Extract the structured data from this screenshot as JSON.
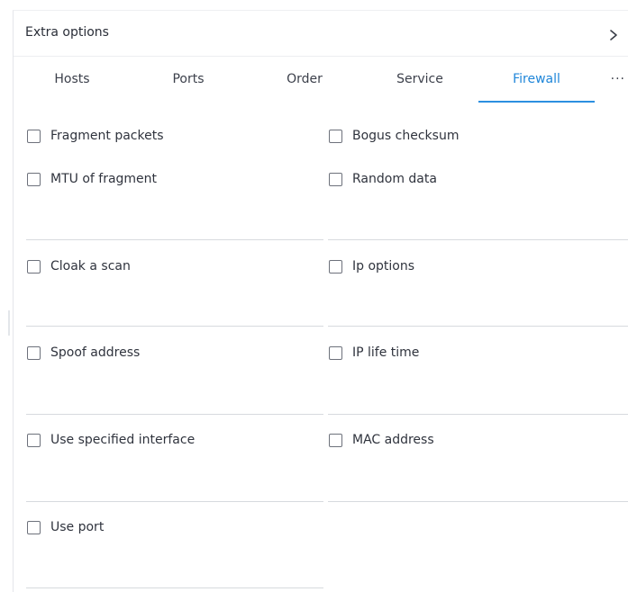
{
  "panel": {
    "title": "Extra options",
    "expand_icon": "chevron-right-icon"
  },
  "tabs": [
    {
      "label": "Hosts",
      "active": false
    },
    {
      "label": "Ports",
      "active": false
    },
    {
      "label": "Order",
      "active": false
    },
    {
      "label": "Service",
      "active": false
    },
    {
      "label": "Firewall",
      "active": true
    }
  ],
  "tabs_more": "···",
  "options": {
    "fragment_packets": {
      "label": "Fragment packets",
      "checked": false
    },
    "bogus_checksum": {
      "label": "Bogus checksum",
      "checked": false
    },
    "mtu_of_fragment": {
      "label": "MTU of fragment",
      "checked": false
    },
    "random_data": {
      "label": "Random data",
      "checked": false
    },
    "cloak_a_scan": {
      "label": "Cloak a scan",
      "checked": false
    },
    "ip_options": {
      "label": "Ip options",
      "checked": false
    },
    "spoof_address": {
      "label": "Spoof address",
      "checked": false
    },
    "ip_life_time": {
      "label": "IP life time",
      "checked": false
    },
    "use_specified_interface": {
      "label": "Use specified interface",
      "checked": false
    },
    "mac_address": {
      "label": "MAC address",
      "checked": false
    },
    "use_port": {
      "label": "Use port",
      "checked": false
    }
  },
  "colors": {
    "accent": "#2b8fe0",
    "text": "#2f333d",
    "divider": "#d7dade"
  }
}
